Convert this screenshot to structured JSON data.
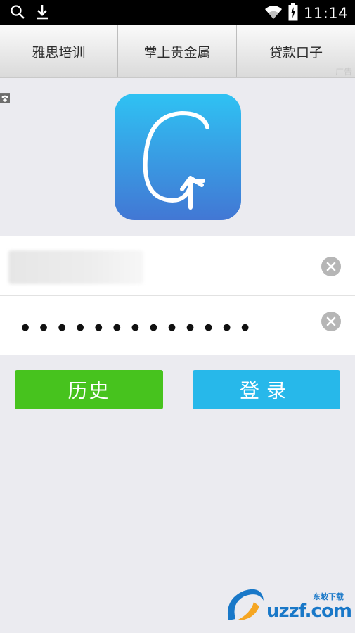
{
  "statusbar": {
    "time": "11:14",
    "icons": [
      "search-icon",
      "download-icon",
      "wifi-icon",
      "battery-icon"
    ]
  },
  "ad_banner": {
    "items": [
      "雅思培训",
      "掌上贵金属",
      "贷款口子"
    ],
    "tag": "广告"
  },
  "login": {
    "username_value": "",
    "password_mask": "•••••••••••••",
    "history_label": "历史",
    "login_label": "登录"
  },
  "colors": {
    "history_button": "#47c31e",
    "login_button": "#27b8ea",
    "logo_top": "#2fc2f3",
    "logo_bottom": "#4277d4",
    "background": "#ebebf0"
  },
  "watermark": {
    "text": "uzzf.com",
    "subtext": "东坡下载"
  }
}
